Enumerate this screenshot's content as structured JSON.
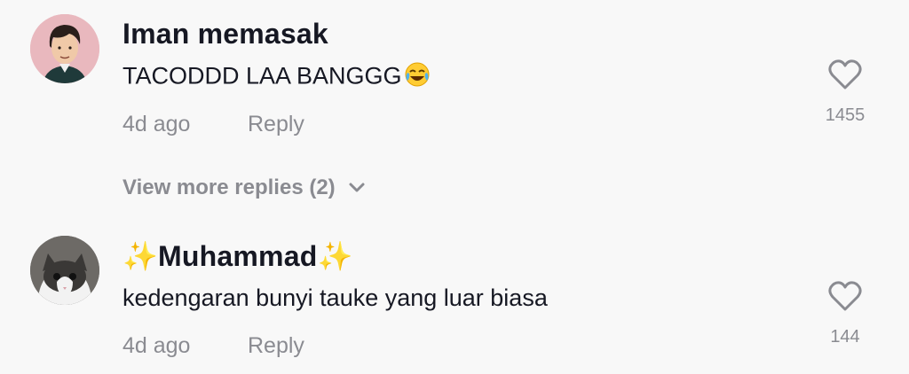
{
  "comments": [
    {
      "username": "Iman memasak",
      "text": "TACODDD LAA BANGGG",
      "emoji_icon": "face-with-tears-of-joy-icon",
      "time": "4d ago",
      "reply_label": "Reply",
      "like_count": "1455",
      "view_more": "View more replies (2)"
    },
    {
      "username_prefix": "✨",
      "username": "Muhammad",
      "username_suffix": "✨",
      "text": "kedengaran bunyi tauke yang luar biasa",
      "time": "4d ago",
      "reply_label": "Reply",
      "like_count": "144"
    }
  ],
  "colors": {
    "background": "#f8f8f8",
    "primary_text": "#161823",
    "secondary_text": "#8a8b91",
    "sparkle": "#f5c518"
  }
}
